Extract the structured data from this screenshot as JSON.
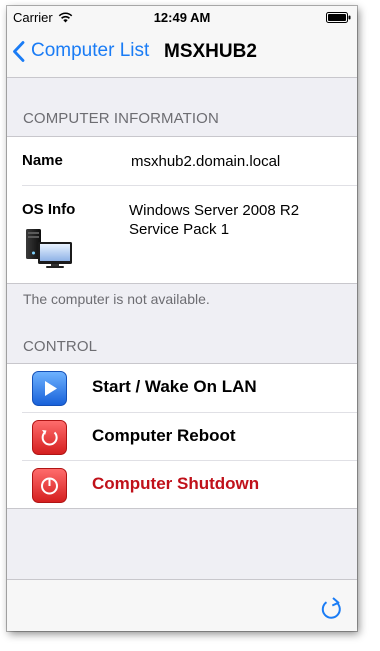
{
  "status_bar": {
    "carrier": "Carrier",
    "time": "12:49 AM",
    "icons": [
      "wifi-icon",
      "battery-icon"
    ]
  },
  "nav": {
    "back_label": "Computer List",
    "title": "MSXHUB2",
    "accent_color": "#1a7cf5"
  },
  "computer_info": {
    "header": "COMPUTER INFORMATION",
    "name_label": "Name",
    "name_value": "msxhub2.domain.local",
    "os_label": "OS Info",
    "os_line1": "Windows Server 2008 R2",
    "os_line2": "Service Pack 1",
    "icon": "computer-icon"
  },
  "availability_note": "The computer is not available.",
  "control": {
    "header": "CONTROL",
    "items": [
      {
        "label": "Start / Wake On LAN",
        "icon": "play-icon",
        "color": "#000000"
      },
      {
        "label": "Computer Reboot",
        "icon": "reboot-icon",
        "color": "#000000"
      },
      {
        "label": "Computer Shutdown",
        "icon": "power-icon",
        "color": "#c0111a"
      }
    ]
  },
  "toolbar": {
    "icon": "refresh-icon"
  }
}
